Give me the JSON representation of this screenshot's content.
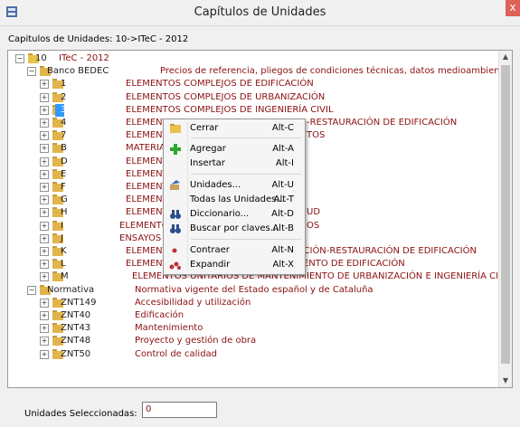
{
  "window": {
    "title": "Capítulos de Unidades",
    "close": "x"
  },
  "caption": "Capitulos de Unidades: 10->ITeC - 2012",
  "tree": {
    "root": {
      "code": "10",
      "desc": "ITeC - 2012",
      "expander": "−"
    },
    "rows": [
      {
        "code": "Banco BEDEC",
        "desc": "Precios de referencia, pliegos de condiciones técnicas, datos medioambientales y producto",
        "expander": "−"
      },
      {
        "code": "1",
        "desc": "ELEMENTOS COMPLEJOS DE EDIFICACIÓN",
        "expander": "+"
      },
      {
        "code": "2",
        "desc": "ELEMENTOS COMPLEJOS DE URBANIZACIÓN",
        "expander": "+"
      },
      {
        "code": "3",
        "desc": "ELEMENTOS COMPLEJOS DE INGENIERÍA CIVIL",
        "expander": "+"
      },
      {
        "code": "4",
        "desc": "ELEMENTO",
        "desc_tail": "-RESTAURACIÓN DE EDIFICACIÓN",
        "expander": "+"
      },
      {
        "code": "7",
        "desc": "ELEMENTO",
        "desc_tail": "TOS",
        "expander": "+"
      },
      {
        "code": "B",
        "desc": "MATERIAL",
        "expander": "+"
      },
      {
        "code": "D",
        "desc": "ELEMENTO",
        "expander": "+"
      },
      {
        "code": "E",
        "desc": "ELEMENTO",
        "expander": "+"
      },
      {
        "code": "F",
        "desc": "ELEMENTO",
        "expander": "+"
      },
      {
        "code": "G",
        "desc": "ELEMENTO",
        "expander": "+"
      },
      {
        "code": "H",
        "desc": "ELEMENTO",
        "desc_tail": "UD",
        "expander": "+"
      },
      {
        "code": "I",
        "desc": "ELEMENTO",
        "desc_tail": "OS",
        "expander": "+"
      },
      {
        "code": "J",
        "desc": "ENSAYOS D",
        "expander": "+"
      },
      {
        "code": "K",
        "desc": "ELEMENTOS UNITARIOS DE REHABILITACIÓN-RESTAURACIÓN DE EDIFICACIÓN",
        "expander": "+"
      },
      {
        "code": "L",
        "desc": "ELEMENTOS UNITARIOS DE MANTENIMIENTO DE EDIFICACIÓN",
        "expander": "+"
      },
      {
        "code": "M",
        "desc": "ELEMENTOS UNITARIOS DE MANTENIMIENTO DE URBANIZACIÓN E INGENIERÍA CIVIL",
        "expander": "+"
      },
      {
        "code": "Normativa",
        "desc": "Normativa vigente del Estado español y de Cataluña",
        "expander": "−"
      },
      {
        "code": "ZNT149",
        "desc": "Accesibilidad y utilización",
        "expander": "+"
      },
      {
        "code": "ZNT40",
        "desc": "Edificación",
        "expander": "+"
      },
      {
        "code": "ZNT43",
        "desc": "Mantenimiento",
        "expander": "+"
      },
      {
        "code": "ZNT48",
        "desc": "Proyecto y gestión de obra",
        "expander": "+"
      },
      {
        "code": "ZNT50",
        "desc": "Control de calidad",
        "expander": "+"
      }
    ]
  },
  "context_menu": {
    "items": [
      {
        "label": "Cerrar",
        "shortcut": "Alt-C",
        "icon": "folder-close-icon"
      },
      {
        "label": "Agregar",
        "shortcut": "Alt-A",
        "icon": "plus-icon"
      },
      {
        "label": "Insertar",
        "shortcut": "Alt-I",
        "icon": ""
      },
      {
        "label": "Unidades...",
        "shortcut": "Alt-U",
        "icon": "units-icon"
      },
      {
        "label": "Todas las Unidades...",
        "shortcut": "Alt-T",
        "icon": ""
      },
      {
        "label": "Diccionario...",
        "shortcut": "Alt-D",
        "icon": "binoculars-icon"
      },
      {
        "label": "Buscar por claves...",
        "shortcut": "Alt-B",
        "icon": "binoculars-icon"
      },
      {
        "label": "Contraer",
        "shortcut": "Alt-N",
        "icon": "collapse-icon"
      },
      {
        "label": "Expandir",
        "shortcut": "Alt-X",
        "icon": "expand-icon"
      }
    ]
  },
  "footer": {
    "label": "Unidades Seleccionadas:",
    "value": "0"
  },
  "colors": {
    "selection": "#3399ff",
    "desc_text": "#8b1010",
    "close": "#e0605a"
  }
}
